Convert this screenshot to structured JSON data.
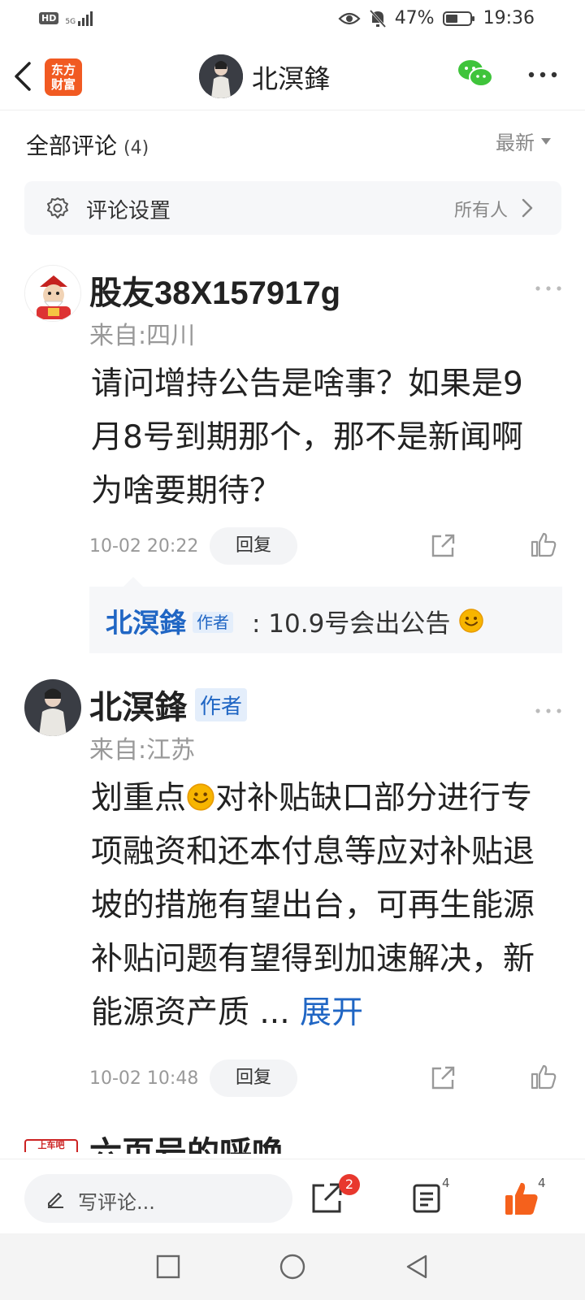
{
  "status_bar": {
    "hd": "HD",
    "network": "5G",
    "battery": "47%",
    "time": "19:36"
  },
  "header": {
    "app_logo_line1": "东方",
    "app_logo_line2": "财富",
    "title": "北溟鋒"
  },
  "comments_header": {
    "title": "全部评论",
    "count": "(4)",
    "sort": "最新"
  },
  "settings": {
    "label": "评论设置",
    "value": "所有人"
  },
  "comments": [
    {
      "username": "股友38X157917g",
      "location": "来自:四川",
      "body": "请问增持公告是啥事？如果是9月8号到期那个，那不是新闻啊为啥要期待？",
      "timestamp": "10-02 20:22",
      "reply_label": "回复",
      "reply": {
        "author": "北溟鋒",
        "tag": "作者",
        "text": ": 10.9号会出公告"
      }
    },
    {
      "username": "北溟鋒",
      "tag": "作者",
      "location": "来自:江苏",
      "body_start": "划重点",
      "body_rest": "对补贴缺口部分进行专项融资和还本付息等应对补贴退坡的措施有望出台，可再生能源补贴问题有望得到加速解决，新能源资产质 ...",
      "expand": "展开",
      "timestamp": "10-02 10:48",
      "reply_label": "回复"
    },
    {
      "username": "六页号的呼唤",
      "avatar_text": "上车吧"
    }
  ],
  "action_bar": {
    "placeholder": "写评论...",
    "share_badge": "2",
    "comment_count": "4",
    "like_count": "4"
  },
  "colors": {
    "accent_blue": "#2066c4",
    "brand_orange": "#f15a22",
    "like_orange": "#f5611c",
    "badge_red": "#e8382e"
  }
}
